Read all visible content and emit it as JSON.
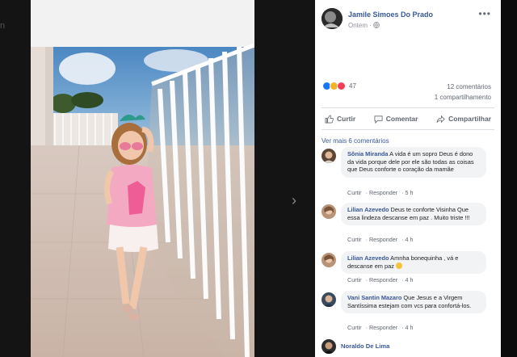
{
  "background": {
    "edge_text": "n"
  },
  "post": {
    "author": "Jamile Simoes Do Prado",
    "meta_label": "Ontem",
    "reactions": {
      "icons": [
        "like-icon",
        "haha-icon",
        "love-icon"
      ],
      "count": "47"
    },
    "comments_count": "12 comentários",
    "shares_count": "1 compartilhamento",
    "actions": {
      "like": "Curtir",
      "comment": "Comentar",
      "share": "Compartilhar"
    },
    "view_more": "Ver mais 6 comentários"
  },
  "comments": [
    {
      "author": "Sônia Miranda",
      "text": "A vida é um sopro Deus é dono da vida porque dele por ele são todas as coisas que Deus conforte o coração da mamãe",
      "like": "Curtir",
      "reply": "Responder",
      "time": "5 h"
    },
    {
      "author": "Lilian Azevedo",
      "text": "Deus te conforte Visinha Que essa lindeza descanse em paz . Muito triste !!!",
      "like": "Curtir",
      "reply": "Responder",
      "time": "4 h"
    },
    {
      "author": "Lilian Azevedo",
      "text": "Amnha bonequinha , vá e descanse em paz",
      "like": "Curtir",
      "reply": "Responder",
      "time": "4 h"
    },
    {
      "author": "Vani Santin Mazaro",
      "text": "Que Jesus e a Virgem Santíssima estejam com vcs para confortá-los.",
      "like": "Curtir",
      "reply": "Responder",
      "time": "4 h"
    }
  ],
  "last_comment_author": "Noraldo De Lima",
  "colors": {
    "link": "#385898",
    "muted": "#606770",
    "bubble": "#f2f3f5"
  }
}
